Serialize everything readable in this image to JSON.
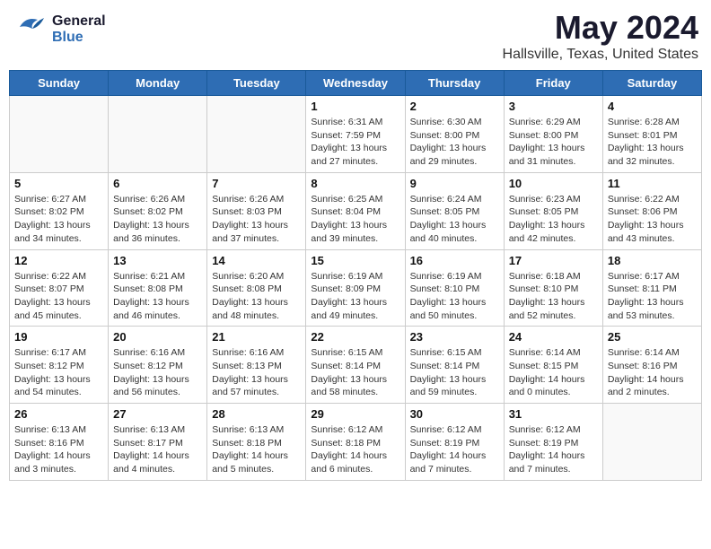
{
  "header": {
    "logo": {
      "general": "General",
      "blue": "Blue"
    },
    "title": "May 2024",
    "subtitle": "Hallsville, Texas, United States"
  },
  "calendar": {
    "days_of_week": [
      "Sunday",
      "Monday",
      "Tuesday",
      "Wednesday",
      "Thursday",
      "Friday",
      "Saturday"
    ],
    "weeks": [
      [
        {
          "day": "",
          "info": ""
        },
        {
          "day": "",
          "info": ""
        },
        {
          "day": "",
          "info": ""
        },
        {
          "day": "1",
          "info": "Sunrise: 6:31 AM\nSunset: 7:59 PM\nDaylight: 13 hours\nand 27 minutes."
        },
        {
          "day": "2",
          "info": "Sunrise: 6:30 AM\nSunset: 8:00 PM\nDaylight: 13 hours\nand 29 minutes."
        },
        {
          "day": "3",
          "info": "Sunrise: 6:29 AM\nSunset: 8:00 PM\nDaylight: 13 hours\nand 31 minutes."
        },
        {
          "day": "4",
          "info": "Sunrise: 6:28 AM\nSunset: 8:01 PM\nDaylight: 13 hours\nand 32 minutes."
        }
      ],
      [
        {
          "day": "5",
          "info": "Sunrise: 6:27 AM\nSunset: 8:02 PM\nDaylight: 13 hours\nand 34 minutes."
        },
        {
          "day": "6",
          "info": "Sunrise: 6:26 AM\nSunset: 8:02 PM\nDaylight: 13 hours\nand 36 minutes."
        },
        {
          "day": "7",
          "info": "Sunrise: 6:26 AM\nSunset: 8:03 PM\nDaylight: 13 hours\nand 37 minutes."
        },
        {
          "day": "8",
          "info": "Sunrise: 6:25 AM\nSunset: 8:04 PM\nDaylight: 13 hours\nand 39 minutes."
        },
        {
          "day": "9",
          "info": "Sunrise: 6:24 AM\nSunset: 8:05 PM\nDaylight: 13 hours\nand 40 minutes."
        },
        {
          "day": "10",
          "info": "Sunrise: 6:23 AM\nSunset: 8:05 PM\nDaylight: 13 hours\nand 42 minutes."
        },
        {
          "day": "11",
          "info": "Sunrise: 6:22 AM\nSunset: 8:06 PM\nDaylight: 13 hours\nand 43 minutes."
        }
      ],
      [
        {
          "day": "12",
          "info": "Sunrise: 6:22 AM\nSunset: 8:07 PM\nDaylight: 13 hours\nand 45 minutes."
        },
        {
          "day": "13",
          "info": "Sunrise: 6:21 AM\nSunset: 8:08 PM\nDaylight: 13 hours\nand 46 minutes."
        },
        {
          "day": "14",
          "info": "Sunrise: 6:20 AM\nSunset: 8:08 PM\nDaylight: 13 hours\nand 48 minutes."
        },
        {
          "day": "15",
          "info": "Sunrise: 6:19 AM\nSunset: 8:09 PM\nDaylight: 13 hours\nand 49 minutes."
        },
        {
          "day": "16",
          "info": "Sunrise: 6:19 AM\nSunset: 8:10 PM\nDaylight: 13 hours\nand 50 minutes."
        },
        {
          "day": "17",
          "info": "Sunrise: 6:18 AM\nSunset: 8:10 PM\nDaylight: 13 hours\nand 52 minutes."
        },
        {
          "day": "18",
          "info": "Sunrise: 6:17 AM\nSunset: 8:11 PM\nDaylight: 13 hours\nand 53 minutes."
        }
      ],
      [
        {
          "day": "19",
          "info": "Sunrise: 6:17 AM\nSunset: 8:12 PM\nDaylight: 13 hours\nand 54 minutes."
        },
        {
          "day": "20",
          "info": "Sunrise: 6:16 AM\nSunset: 8:12 PM\nDaylight: 13 hours\nand 56 minutes."
        },
        {
          "day": "21",
          "info": "Sunrise: 6:16 AM\nSunset: 8:13 PM\nDaylight: 13 hours\nand 57 minutes."
        },
        {
          "day": "22",
          "info": "Sunrise: 6:15 AM\nSunset: 8:14 PM\nDaylight: 13 hours\nand 58 minutes."
        },
        {
          "day": "23",
          "info": "Sunrise: 6:15 AM\nSunset: 8:14 PM\nDaylight: 13 hours\nand 59 minutes."
        },
        {
          "day": "24",
          "info": "Sunrise: 6:14 AM\nSunset: 8:15 PM\nDaylight: 14 hours\nand 0 minutes."
        },
        {
          "day": "25",
          "info": "Sunrise: 6:14 AM\nSunset: 8:16 PM\nDaylight: 14 hours\nand 2 minutes."
        }
      ],
      [
        {
          "day": "26",
          "info": "Sunrise: 6:13 AM\nSunset: 8:16 PM\nDaylight: 14 hours\nand 3 minutes."
        },
        {
          "day": "27",
          "info": "Sunrise: 6:13 AM\nSunset: 8:17 PM\nDaylight: 14 hours\nand 4 minutes."
        },
        {
          "day": "28",
          "info": "Sunrise: 6:13 AM\nSunset: 8:18 PM\nDaylight: 14 hours\nand 5 minutes."
        },
        {
          "day": "29",
          "info": "Sunrise: 6:12 AM\nSunset: 8:18 PM\nDaylight: 14 hours\nand 6 minutes."
        },
        {
          "day": "30",
          "info": "Sunrise: 6:12 AM\nSunset: 8:19 PM\nDaylight: 14 hours\nand 7 minutes."
        },
        {
          "day": "31",
          "info": "Sunrise: 6:12 AM\nSunset: 8:19 PM\nDaylight: 14 hours\nand 7 minutes."
        },
        {
          "day": "",
          "info": ""
        }
      ]
    ]
  }
}
